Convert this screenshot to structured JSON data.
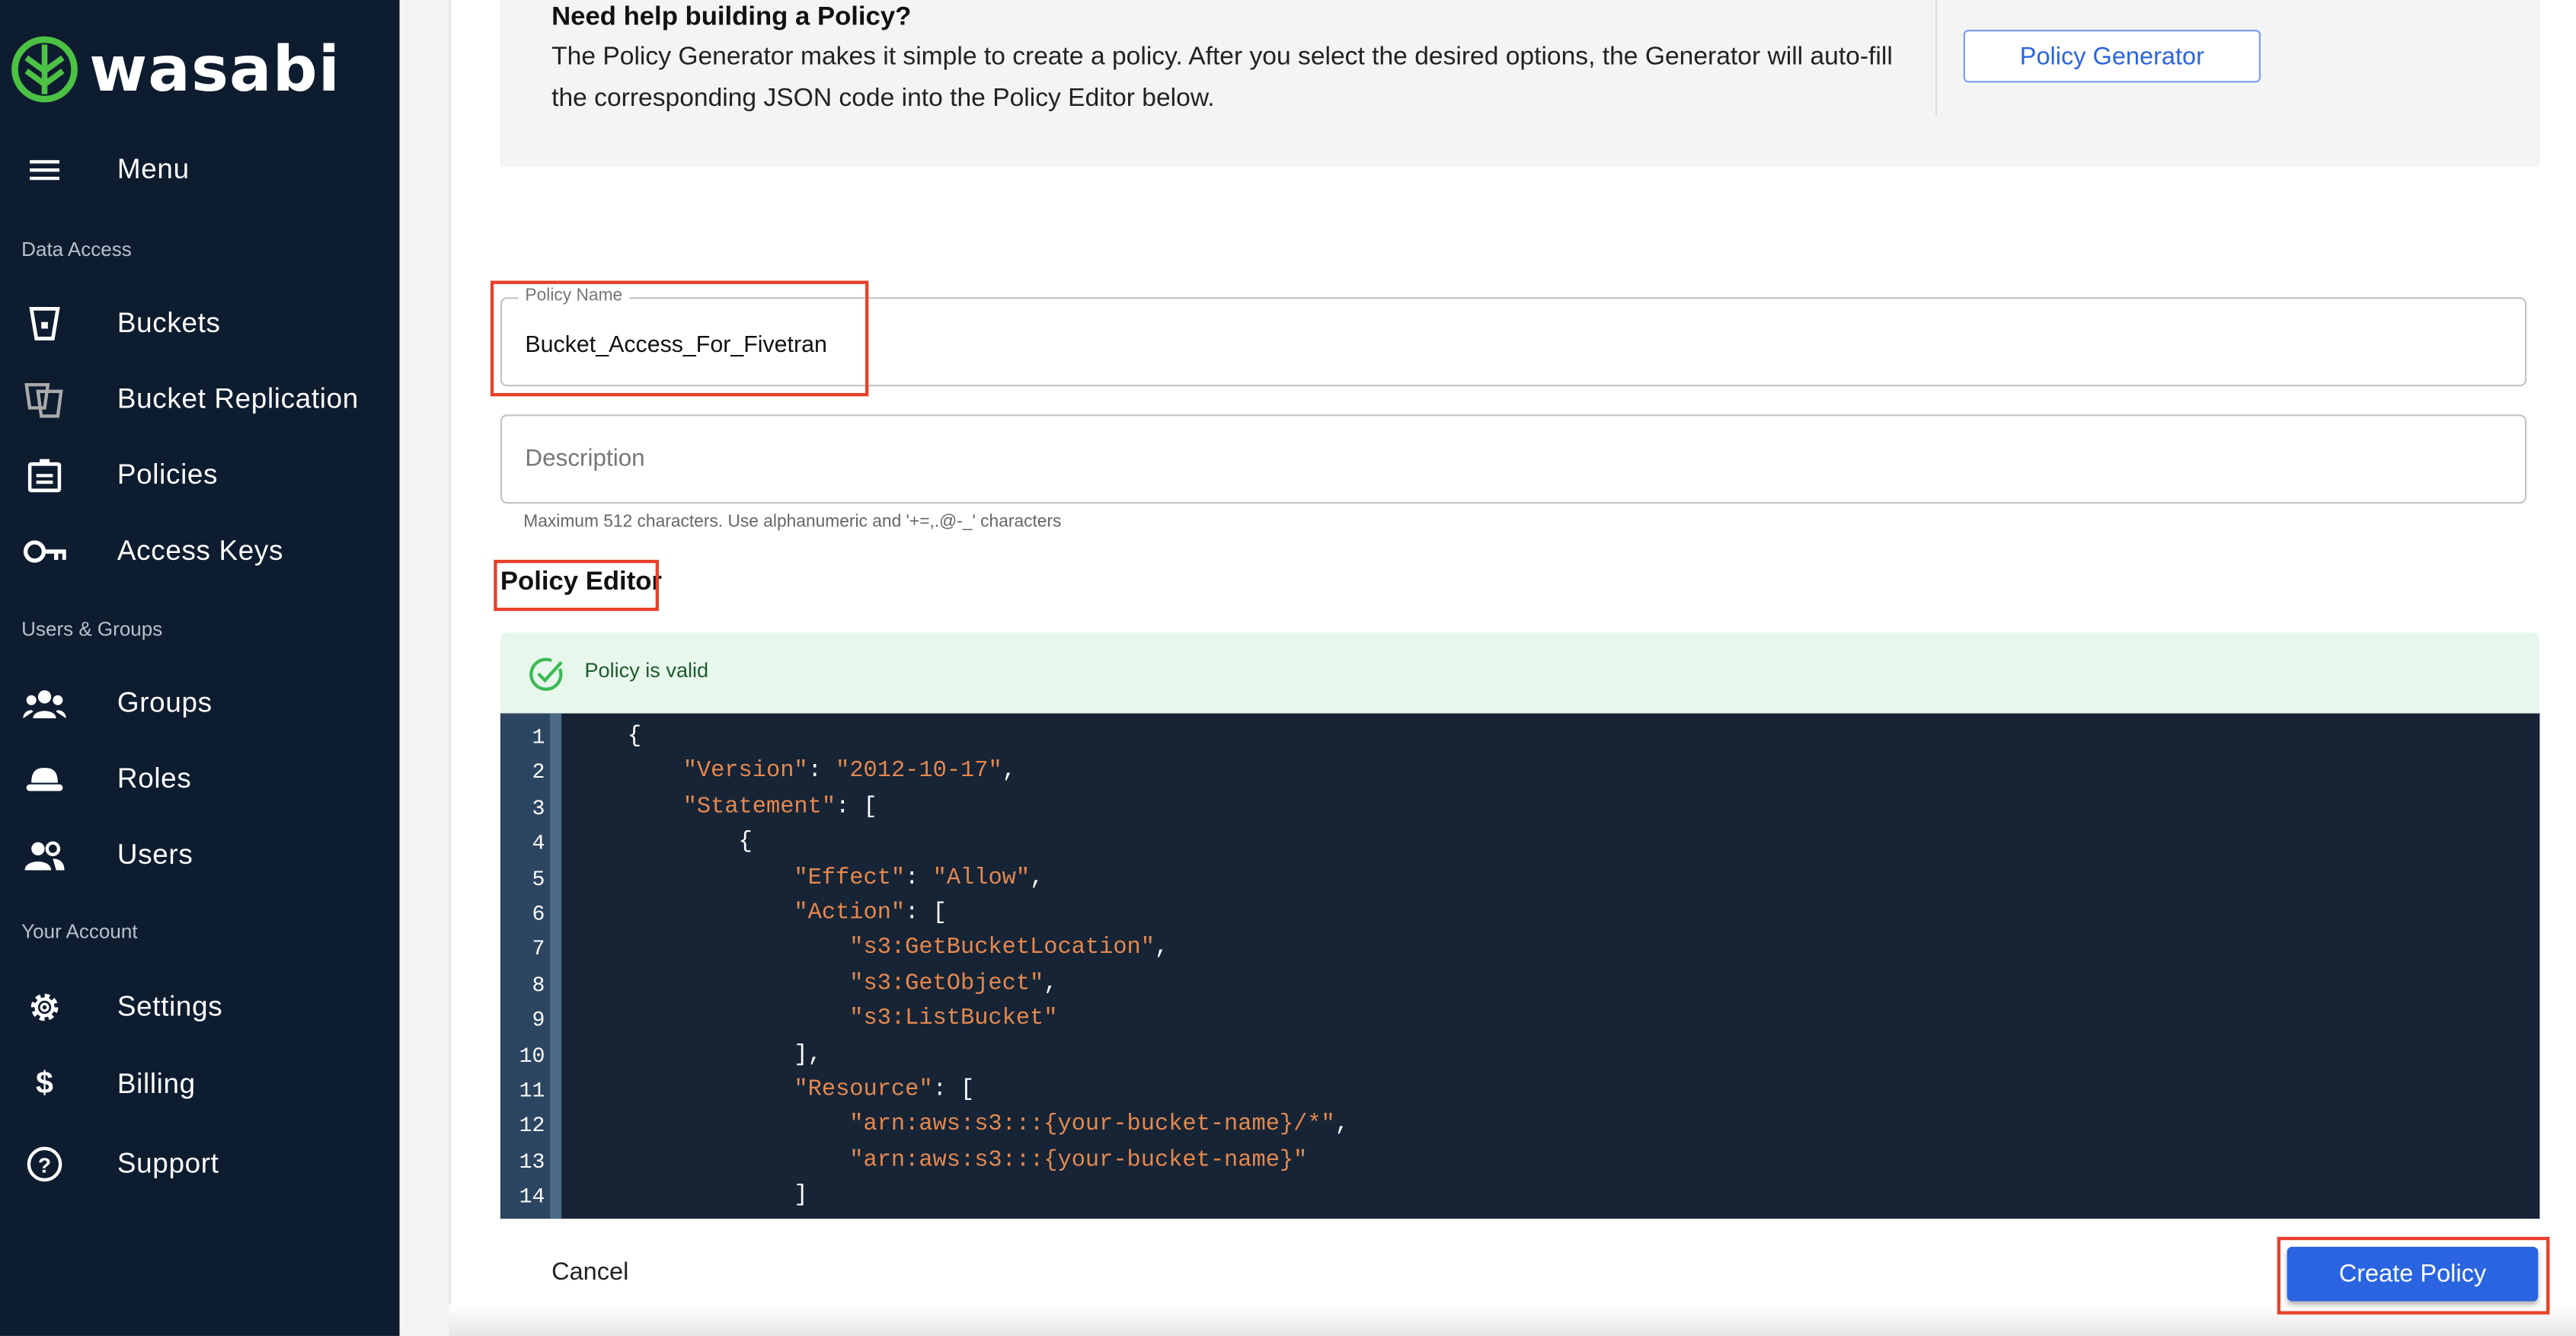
{
  "brand": {
    "name": "wasabi",
    "logo_color": "#4cc143"
  },
  "sidebar": {
    "menu_label": "Menu",
    "sections": [
      "Data Access",
      "Users & Groups",
      "Your Account"
    ],
    "items": [
      {
        "label": "Buckets",
        "icon": "bucket-icon"
      },
      {
        "label": "Bucket Replication",
        "icon": "bucket-replication-icon"
      },
      {
        "label": "Policies",
        "icon": "clipboard-icon"
      },
      {
        "label": "Access Keys",
        "icon": "key-icon"
      },
      {
        "label": "Groups",
        "icon": "groups-icon"
      },
      {
        "label": "Roles",
        "icon": "hat-icon"
      },
      {
        "label": "Users",
        "icon": "users-icon"
      },
      {
        "label": "Settings",
        "icon": "gear-icon"
      },
      {
        "label": "Billing",
        "icon": "dollar-icon"
      },
      {
        "label": "Support",
        "icon": "help-circle-icon"
      }
    ]
  },
  "help": {
    "title": "Need help building a Policy?",
    "body": "The Policy Generator makes it simple to create a policy. After you select the desired options, the Generator will auto-fill the corresponding JSON code into the Policy Editor below.",
    "button": "Policy Generator"
  },
  "form": {
    "policy_name_label": "Policy Name",
    "policy_name_value": "Bucket_Access_For_Fivetran",
    "description_placeholder": "Description",
    "description_hint": "Maximum 512 characters. Use alphanumeric and '+=,.@-_' characters"
  },
  "editor": {
    "heading": "Policy Editor",
    "status": "Policy is valid",
    "lines": [
      "{",
      "    \"Version\": \"2012-10-17\",",
      "    \"Statement\": [",
      "        {",
      "            \"Effect\": \"Allow\",",
      "            \"Action\": [",
      "                \"s3:GetBucketLocation\",",
      "                \"s3:GetObject\",",
      "                \"s3:ListBucket\"",
      "            ],",
      "            \"Resource\": [",
      "                \"arn:aws:s3:::{your-bucket-name}/*\",",
      "                \"arn:aws:s3:::{your-bucket-name}\"",
      "            ]"
    ]
  },
  "actions": {
    "cancel": "Cancel",
    "create": "Create Policy"
  },
  "colors": {
    "sidebar": "#0e1c2f",
    "accent": "#2a64e0",
    "highlight": "#e8402a",
    "string": "#e5884f",
    "valid_bg": "#e8f7ec"
  }
}
